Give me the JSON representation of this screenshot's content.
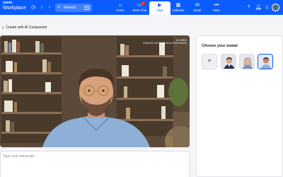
{
  "app": {
    "logo_line1": "zoom",
    "logo_line2": "Workplace"
  },
  "toolbar": {
    "history_icon": "clock-icon",
    "back_icon": "chevron-left-icon",
    "forward_icon": "chevron-right-icon",
    "search_placeholder": "Search",
    "search_shortcut": "⌘F"
  },
  "nav": [
    {
      "label": "Home",
      "icon": "home-icon"
    },
    {
      "label": "Team Chat",
      "icon": "chat-icon",
      "badge": "1"
    },
    {
      "label": "Clips",
      "icon": "clips-icon",
      "active": true
    },
    {
      "label": "Calendar",
      "icon": "calendar-icon"
    },
    {
      "label": "Email",
      "icon": "email-icon"
    },
    {
      "label": "More",
      "icon": "more-icon"
    }
  ],
  "right_icons": [
    "help-icon",
    "notification-icon",
    "apps-grid-icon"
  ],
  "page": {
    "back_label": "Create with AI Companion"
  },
  "video": {
    "tag_line1": "AI VIDEO",
    "tag_line2": "CREATED WITH ZOOM AI COMPANION"
  },
  "transcript": {
    "placeholder": "Type your transcript..."
  },
  "avatar_panel": {
    "title": "Choose your avatar",
    "add_symbol": "+",
    "avatars": [
      {
        "name": "avatar-man-suit",
        "selected": false
      },
      {
        "name": "avatar-woman",
        "selected": false
      },
      {
        "name": "avatar-man-glasses",
        "selected": true
      }
    ]
  },
  "colors": {
    "brand": "#0b5cff",
    "background": "#f5f5f7",
    "badge": "#e02020"
  }
}
